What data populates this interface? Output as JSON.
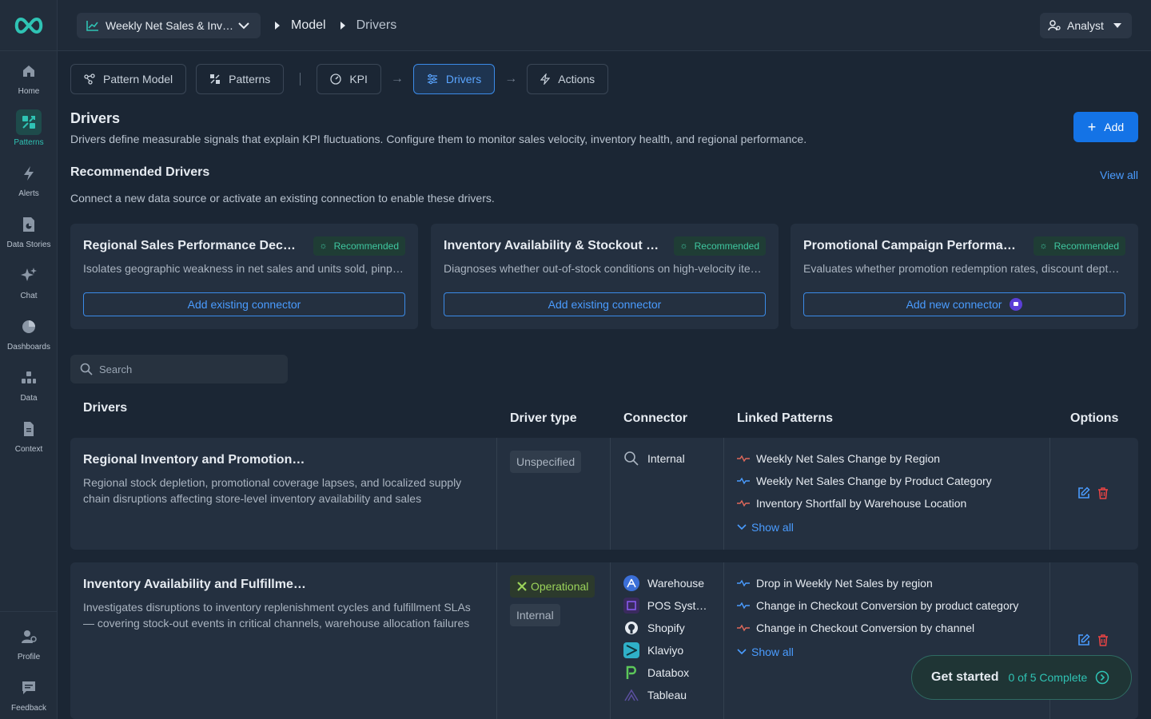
{
  "header": {
    "model_name": "Weekly Net Sales & Inventory",
    "breadcrumb": [
      "Model",
      "Drivers"
    ],
    "role": "Analyst"
  },
  "sidebar": {
    "items": [
      {
        "label": "Home",
        "icon": "home-icon"
      },
      {
        "label": "Patterns",
        "icon": "patterns-icon",
        "active": true
      },
      {
        "label": "Alerts",
        "icon": "bolt-icon"
      },
      {
        "label": "Data Stories",
        "icon": "data-stories-icon"
      },
      {
        "label": "Chat",
        "icon": "sparkle-icon"
      },
      {
        "label": "Dashboards",
        "icon": "pie-icon"
      },
      {
        "label": "Data",
        "icon": "data-icon"
      },
      {
        "label": "Context",
        "icon": "document-icon"
      }
    ],
    "bottom": [
      {
        "label": "Profile",
        "icon": "profile-icon"
      },
      {
        "label": "Feedback",
        "icon": "feedback-icon"
      }
    ]
  },
  "tabs": [
    "Pattern Model",
    "Patterns",
    "KPI",
    "Drivers",
    "Actions"
  ],
  "page": {
    "title": "Drivers",
    "description": "Drivers define measurable signals that explain KPI fluctuations. Configure them to monitor sales velocity, inventory health, and regional performance.",
    "add_label": "Add"
  },
  "recommended": {
    "title": "Recommended Drivers",
    "view_all": "View all",
    "description": "Connect a new data source or activate an existing connection to enable these drivers.",
    "badge": "Recommended",
    "cards": [
      {
        "title": "Regional Sales Performance Decline",
        "description": "Isolates geographic weakness in net sales and units sold, pinpointing regions with sustained declines.",
        "button": "Add existing connector"
      },
      {
        "title": "Inventory Availability & Stockout Impact",
        "description": "Diagnoses whether out-of-stock conditions on high-velocity items are suppressing sales.",
        "button": "Add existing connector"
      },
      {
        "title": "Promotional Campaign Performance",
        "description": "Evaluates whether promotion redemption rates, discount depth and timing drive sales lift.",
        "button": "Add new connector"
      }
    ]
  },
  "search": {
    "placeholder": "Search"
  },
  "table": {
    "headers": [
      "Drivers",
      "Driver type",
      "Connector",
      "Linked Patterns",
      "Options"
    ],
    "rows": [
      {
        "title": "Regional Inventory and Promotional Gaps",
        "description": "Regional stock depletion, promotional coverage lapses, and localized supply chain disruptions affecting store-level inventory availability and sales performance.",
        "types": [
          "Unspecified"
        ],
        "connectors": [
          {
            "name": "Internal",
            "icon": "search-icon"
          }
        ],
        "patterns": [
          "Weekly Net Sales Change by Region",
          "Weekly Net Sales Change by Product Category",
          "Inventory Shortfall by Warehouse Location"
        ],
        "show_all": "Show all"
      },
      {
        "title": "Inventory Availability and Fulfillment Disruptions",
        "description": "Investigates disruptions to inventory replenishment cycles and fulfillment SLAs — covering stock-out events in critical channels, warehouse allocation failures and delays.",
        "types": [
          "Operational",
          "Internal"
        ],
        "connectors": [
          {
            "name": "Warehouse",
            "icon": "warehouse-icon",
            "color": "#3b6fd8"
          },
          {
            "name": "POS System",
            "icon": "pos-icon",
            "color": "#6b3fc8"
          },
          {
            "name": "Shopify",
            "icon": "github-icon",
            "color": "#e6ebf1"
          },
          {
            "name": "Klaviyo",
            "icon": "klaviyo-icon",
            "color": "#2fb0c8"
          },
          {
            "name": "Databox",
            "icon": "databox-icon",
            "color": "#5cc85a"
          },
          {
            "name": "Tableau",
            "icon": "tableau-icon",
            "color": "#8e7ad8"
          }
        ],
        "patterns": [
          "Drop in Weekly Net Sales by region",
          "Change in Checkout Conversion by product category",
          "Change in Checkout Conversion by channel"
        ],
        "show_all": "Show all"
      }
    ]
  },
  "get_started": {
    "title": "Get started",
    "progress": "0 of 5 Complete"
  },
  "colors": {
    "accent": "#1473e6",
    "teal": "#2fc3b4",
    "operational": "#9bd35a"
  }
}
